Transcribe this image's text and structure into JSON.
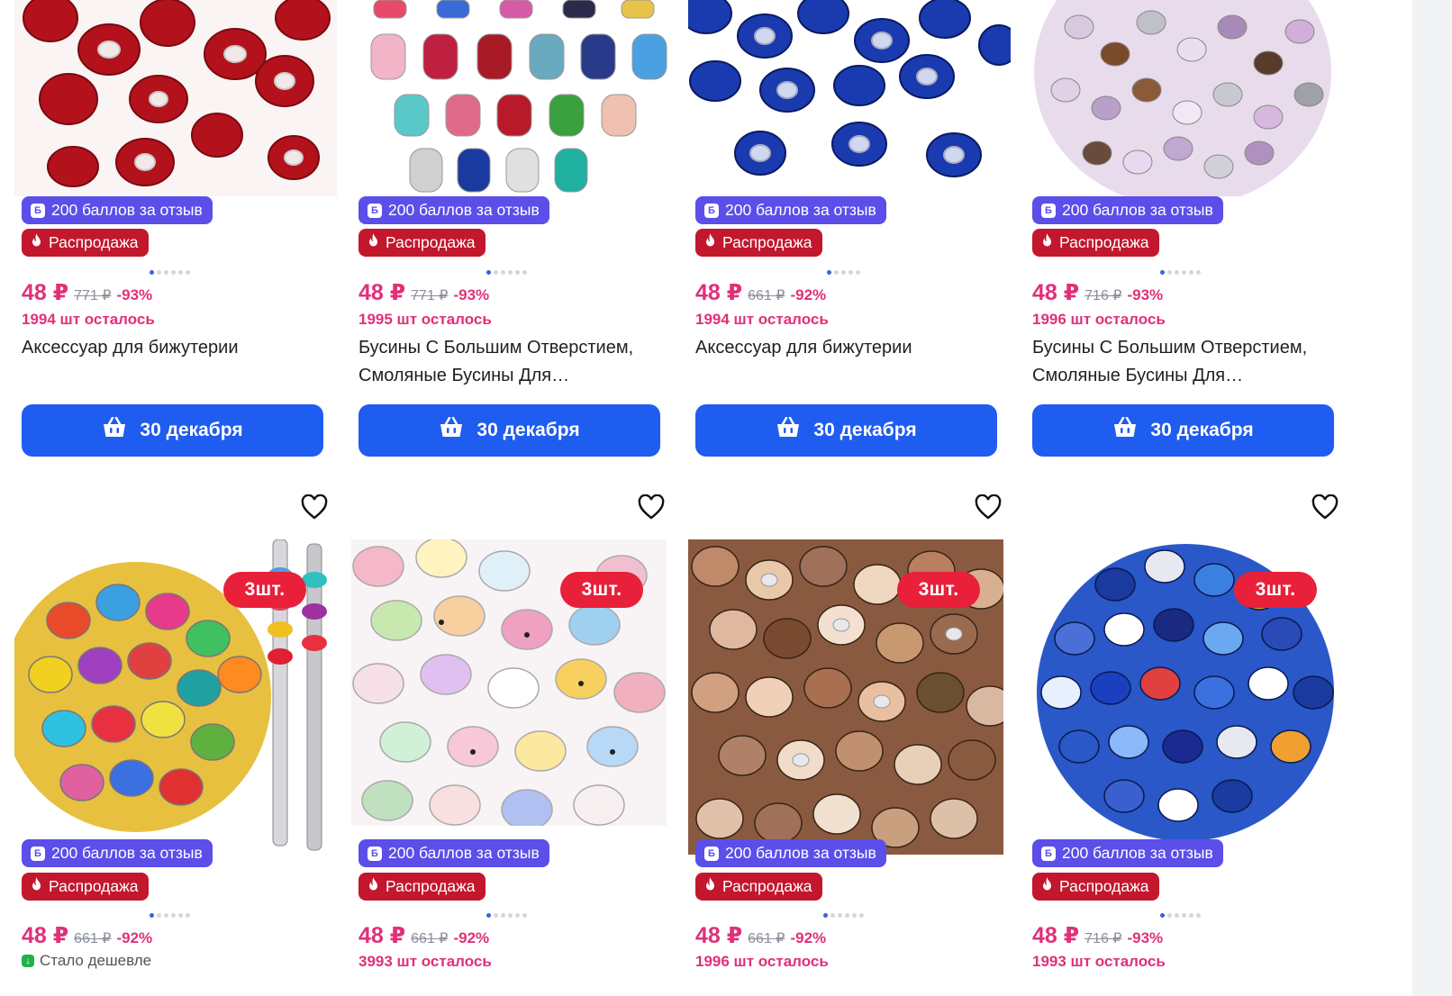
{
  "colors": {
    "accent_blue": "#1f5cf0",
    "review_badge": "#5b4ee9",
    "sale_badge": "#c3172d",
    "price_pink": "#e0307a",
    "qty_badge": "#e8203a"
  },
  "row1": [
    {
      "review_badge": "200 баллов за отзыв",
      "review_icon": "Б",
      "sale_badge": "Распродажа",
      "price": "48 ₽",
      "old_price": "771 ₽",
      "discount": "-93%",
      "stock": "1994 шт осталось",
      "title": "Аксессуар для бижутерии",
      "button": "30 декабря"
    },
    {
      "review_badge": "200 баллов за отзыв",
      "review_icon": "Б",
      "sale_badge": "Распродажа",
      "price": "48 ₽",
      "old_price": "771 ₽",
      "discount": "-93%",
      "stock": "1995 шт осталось",
      "title": "Бусины С Большим Отверстием, Смоляные Бусины Для…",
      "button": "30 декабря"
    },
    {
      "review_badge": "200 баллов за отзыв",
      "review_icon": "Б",
      "sale_badge": "Распродажа",
      "price": "48 ₽",
      "old_price": "661 ₽",
      "discount": "-92%",
      "stock": "1994 шт осталось",
      "title": "Аксессуар для бижутерии",
      "button": "30 декабря"
    },
    {
      "review_badge": "200 баллов за отзыв",
      "review_icon": "Б",
      "sale_badge": "Распродажа",
      "price": "48 ₽",
      "old_price": "716 ₽",
      "discount": "-93%",
      "stock": "1996 шт осталось",
      "title": "Бусины С Большим Отверстием, Смоляные Бусины Для…",
      "button": "30 декабря"
    }
  ],
  "row2": [
    {
      "qty_badge": "3шт.",
      "review_badge": "200 баллов за отзыв",
      "review_icon": "Б",
      "sale_badge": "Распродажа",
      "price": "48 ₽",
      "old_price": "661 ₽",
      "discount": "-92%",
      "stock_note": "Стало дешевле"
    },
    {
      "qty_badge": "3шт.",
      "review_badge": "200 баллов за отзыв",
      "review_icon": "Б",
      "sale_badge": "Распродажа",
      "price": "48 ₽",
      "old_price": "661 ₽",
      "discount": "-92%",
      "stock": "3993 шт осталось"
    },
    {
      "qty_badge": "3шт.",
      "review_badge": "200 баллов за отзыв",
      "review_icon": "Б",
      "sale_badge": "Распродажа",
      "price": "48 ₽",
      "old_price": "661 ₽",
      "discount": "-92%",
      "stock": "1996 шт осталось"
    },
    {
      "qty_badge": "3шт.",
      "review_badge": "200 баллов за отзыв",
      "review_icon": "Б",
      "sale_badge": "Распродажа",
      "price": "48 ₽",
      "old_price": "716 ₽",
      "discount": "-93%",
      "stock": "1993 шт осталось"
    }
  ],
  "icons": {
    "favorite": "heart-icon",
    "cart": "basket-icon",
    "sale": "fire-icon",
    "review": "points-icon",
    "price_drop": "arrow-down-icon"
  }
}
